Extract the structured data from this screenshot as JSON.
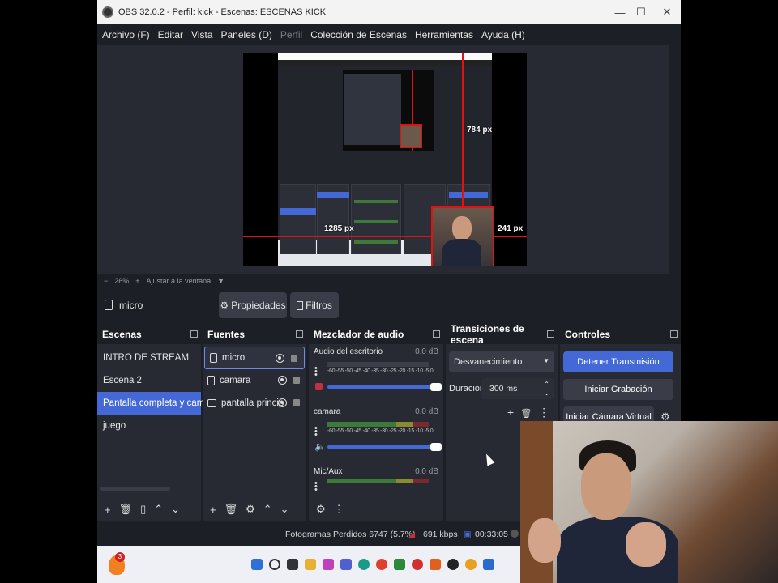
{
  "window": {
    "title": "OBS 32.0.2 - Perfil: kick - Escenas: ESCENAS KICK",
    "minimize": "—",
    "maximize": "☐",
    "close": "✕"
  },
  "menu": [
    {
      "label": "Archivo (F)",
      "enabled": true
    },
    {
      "label": "Editar",
      "enabled": true
    },
    {
      "label": "Vista",
      "enabled": true
    },
    {
      "label": "Paneles (D)",
      "enabled": true
    },
    {
      "label": "Perfil",
      "enabled": false
    },
    {
      "label": "Colección de Escenas",
      "enabled": true
    },
    {
      "label": "Herramientas",
      "enabled": true
    },
    {
      "label": "Ayuda (H)",
      "enabled": true
    }
  ],
  "preview": {
    "label_height": "784 px",
    "label_width": "1285 px",
    "label_side": "241 px"
  },
  "zoom": {
    "minus": "−",
    "level": "26%",
    "plus": "+",
    "fit": "Ajustar a la ventana",
    "arrow": "▼"
  },
  "selected_source": {
    "name": "micro",
    "properties": "Propiedades",
    "filters": "Filtros"
  },
  "scenes": {
    "title": "Escenas",
    "items": [
      {
        "label": "INTRO DE STREAM",
        "active": false
      },
      {
        "label": "Escena 2",
        "active": false
      },
      {
        "label": "Pantalla completa y camara",
        "active": true
      },
      {
        "label": "juego",
        "active": false
      }
    ]
  },
  "sources": {
    "title": "Fuentes",
    "items": [
      {
        "label": "micro",
        "active": true
      },
      {
        "label": "camara",
        "active": false
      },
      {
        "label": "pantalla princip",
        "active": false
      }
    ]
  },
  "mixer": {
    "title": "Mezclador de audio",
    "ticks": "-60 -55 -50 -45 -40 -35 -30 -25 -20 -15 -10 -5 0",
    "channels": [
      {
        "name": "Audio del escritorio",
        "db": "0.0 dB",
        "muted": true
      },
      {
        "name": "camara",
        "db": "0.0 dB",
        "muted": false
      },
      {
        "name": "Mic/Aux",
        "db": "0.0 dB",
        "muted": false
      }
    ]
  },
  "transitions": {
    "title": "Transiciones de escena",
    "selected": "Desvanecimiento",
    "duration_label": "Duración",
    "duration_value": "300 ms"
  },
  "controls": {
    "title": "Controles",
    "stop_stream": "Detener Transmisión",
    "start_recording": "Iniciar Grabación",
    "start_virtual_cam": "Iniciar Cámara Virtual"
  },
  "status": {
    "dropped_frames": "Fotogramas Perdidos 6747 (5.7%)",
    "bitrate": "691 kbps",
    "stream_time": "00:33:05"
  },
  "taskbar": {
    "notification_count": "3"
  },
  "colors": {
    "accent": "#4469d6",
    "bg": "#1d1f26",
    "dock": "#272a33",
    "guide_red": "#e01313"
  }
}
